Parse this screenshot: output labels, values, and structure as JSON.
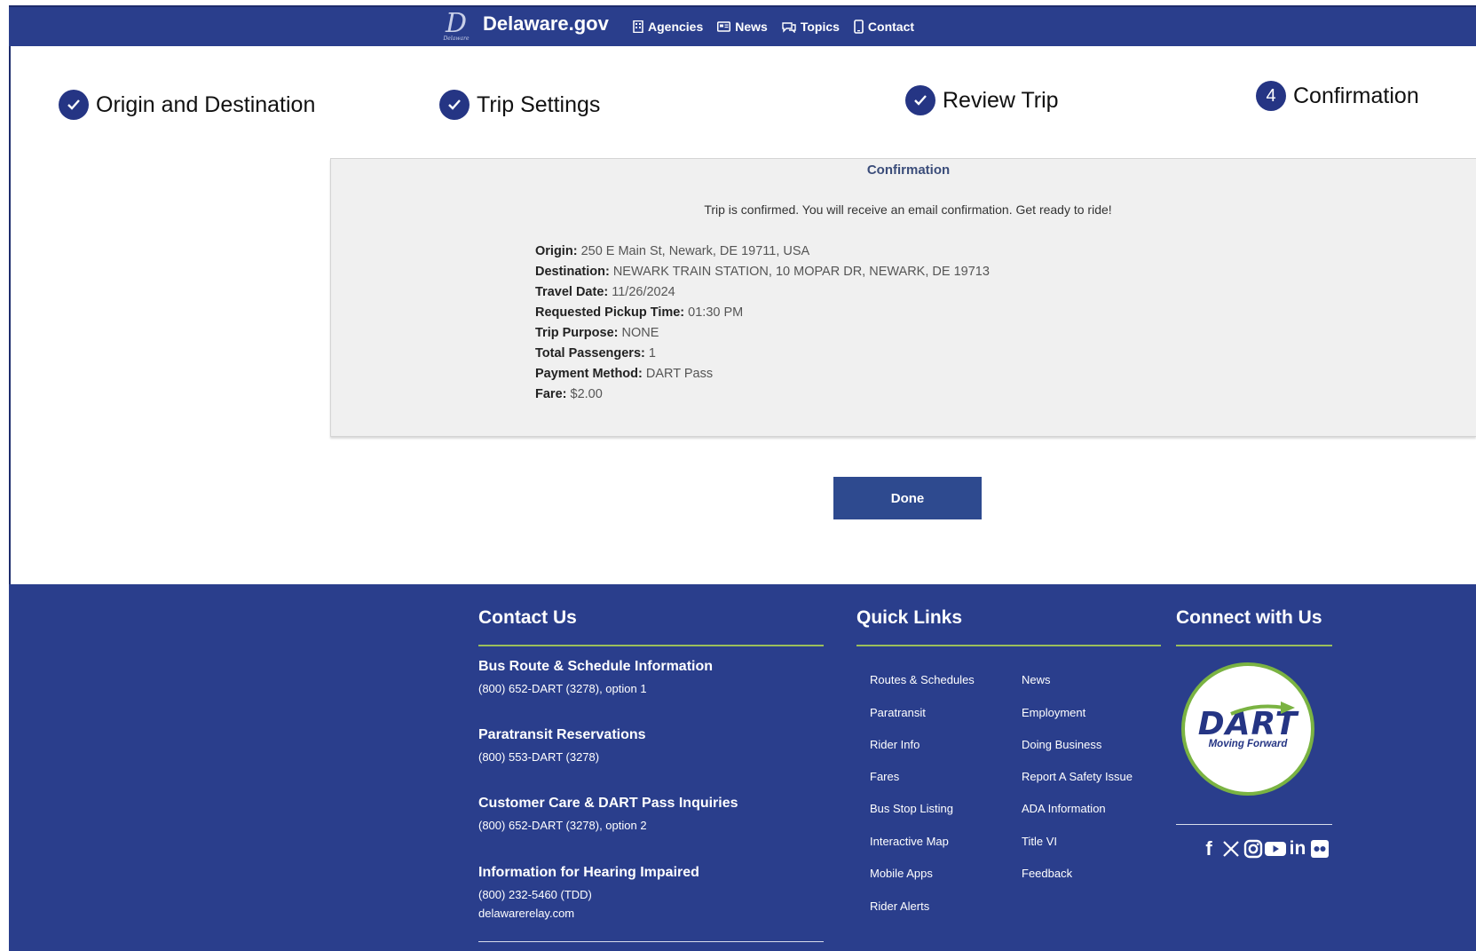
{
  "header": {
    "logo_glyph": "D",
    "logo_small": "Delaware",
    "site_title": "Delaware.gov",
    "nav": [
      {
        "label": "Agencies",
        "icon": "building-icon"
      },
      {
        "label": "News",
        "icon": "newspaper-icon"
      },
      {
        "label": "Topics",
        "icon": "chat-icon"
      },
      {
        "label": "Contact",
        "icon": "phone-icon"
      }
    ]
  },
  "stepper": {
    "steps": [
      {
        "label": "Origin and Destination",
        "state": "complete"
      },
      {
        "label": "Trip Settings",
        "state": "complete"
      },
      {
        "label": "Review Trip",
        "state": "complete"
      },
      {
        "label": "Confirmation",
        "state": "current",
        "number": "4"
      }
    ],
    "check_color": "#253584"
  },
  "confirmation": {
    "title": "Confirmation",
    "message": "Trip is confirmed. You will receive an email confirmation. Get ready to ride!",
    "fields": [
      {
        "label": "Origin:",
        "value": "250 E Main St, Newark, DE 19711, USA"
      },
      {
        "label": "Destination:",
        "value": "NEWARK TRAIN STATION, 10 MOPAR DR, NEWARK, DE 19713"
      },
      {
        "label": "Travel Date:",
        "value": "11/26/2024"
      },
      {
        "label": "Requested Pickup Time:",
        "value": "01:30 PM"
      },
      {
        "label": "Trip Purpose:",
        "value": "NONE"
      },
      {
        "label": "Total Passengers:",
        "value": "1"
      },
      {
        "label": "Payment Method:",
        "value": "DART Pass"
      },
      {
        "label": "Fare:",
        "value": "$2.00"
      }
    ],
    "done_label": "Done"
  },
  "footer": {
    "contact_heading": "Contact Us",
    "contacts": [
      {
        "title": "Bus Route & Schedule Information",
        "lines": [
          "(800) 652-DART (3278), option 1"
        ]
      },
      {
        "title": "Paratransit Reservations",
        "lines": [
          "(800) 553-DART (3278)"
        ]
      },
      {
        "title": "Customer Care & DART Pass Inquiries",
        "lines": [
          "(800) 652-DART (3278), option 2"
        ]
      },
      {
        "title": "Information for Hearing Impaired",
        "lines": [
          "(800) 232-5460 (TDD)",
          "delawarerelay.com"
        ]
      }
    ],
    "quick_links_heading": "Quick Links",
    "quick_links_col1": [
      "Routes & Schedules",
      "Paratransit",
      "Rider Info",
      "Fares",
      "Bus Stop Listing",
      "Interactive Map",
      "Mobile Apps",
      "Rider Alerts"
    ],
    "quick_links_col2": [
      "News",
      "Employment",
      "Doing Business",
      "Report A Safety Issue",
      "ADA Information",
      "Title VI",
      "Feedback"
    ],
    "connect_heading": "Connect with Us",
    "dart_logo": {
      "word": "DART",
      "tagline": "Moving Forward"
    },
    "social_icons": [
      "facebook-icon",
      "x-icon",
      "instagram-icon",
      "youtube-icon",
      "linkedin-icon",
      "flickr-icon"
    ],
    "colors": {
      "background": "#2a3e8c",
      "accent_rule": "#9bbf5a"
    }
  }
}
